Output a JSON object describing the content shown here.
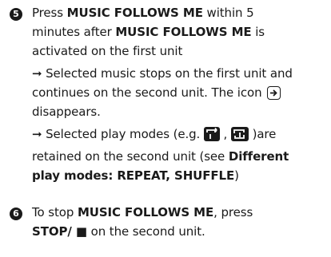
{
  "step5": {
    "number": "5",
    "line1_prefix": "Press ",
    "line1_bold": "MUSIC FOLLOWS ME",
    "line1_suffix": " within 5",
    "line2_prefix": "minutes after ",
    "line2_bold": "MUSIC FOLLOWS ME",
    "line2_suffix": " is",
    "line3": "activated on the first unit",
    "sub1_arrow": "➞",
    "sub1_line1": " Selected music stops on the first unit and",
    "sub1_line2": "continues on the second unit.  The icon ",
    "sub1_line3": "disappears.",
    "sub2_arrow": "➞",
    "sub2_line1_a": " Selected play modes (e.g. ",
    "sub2_line1_sep": " ,  ",
    "sub2_line1_b": " )are",
    "sub2_line2_a": "retained on the second unit (see ",
    "sub2_line2_bold": "Different",
    "sub2_line3_bold": "play modes: REPEAT, SHUFFLE",
    "sub2_line3_end": ")",
    "icons": [
      "music-follows-me-icon",
      "repeat-icon",
      "shuffle-icon"
    ]
  },
  "step6": {
    "number": "6",
    "line1_prefix": "To stop ",
    "line1_bold": "MUSIC FOLLOWS ME",
    "line1_suffix": ", press",
    "line2_bold": "STOP/ ■",
    "line2_suffix": " on the second unit."
  }
}
